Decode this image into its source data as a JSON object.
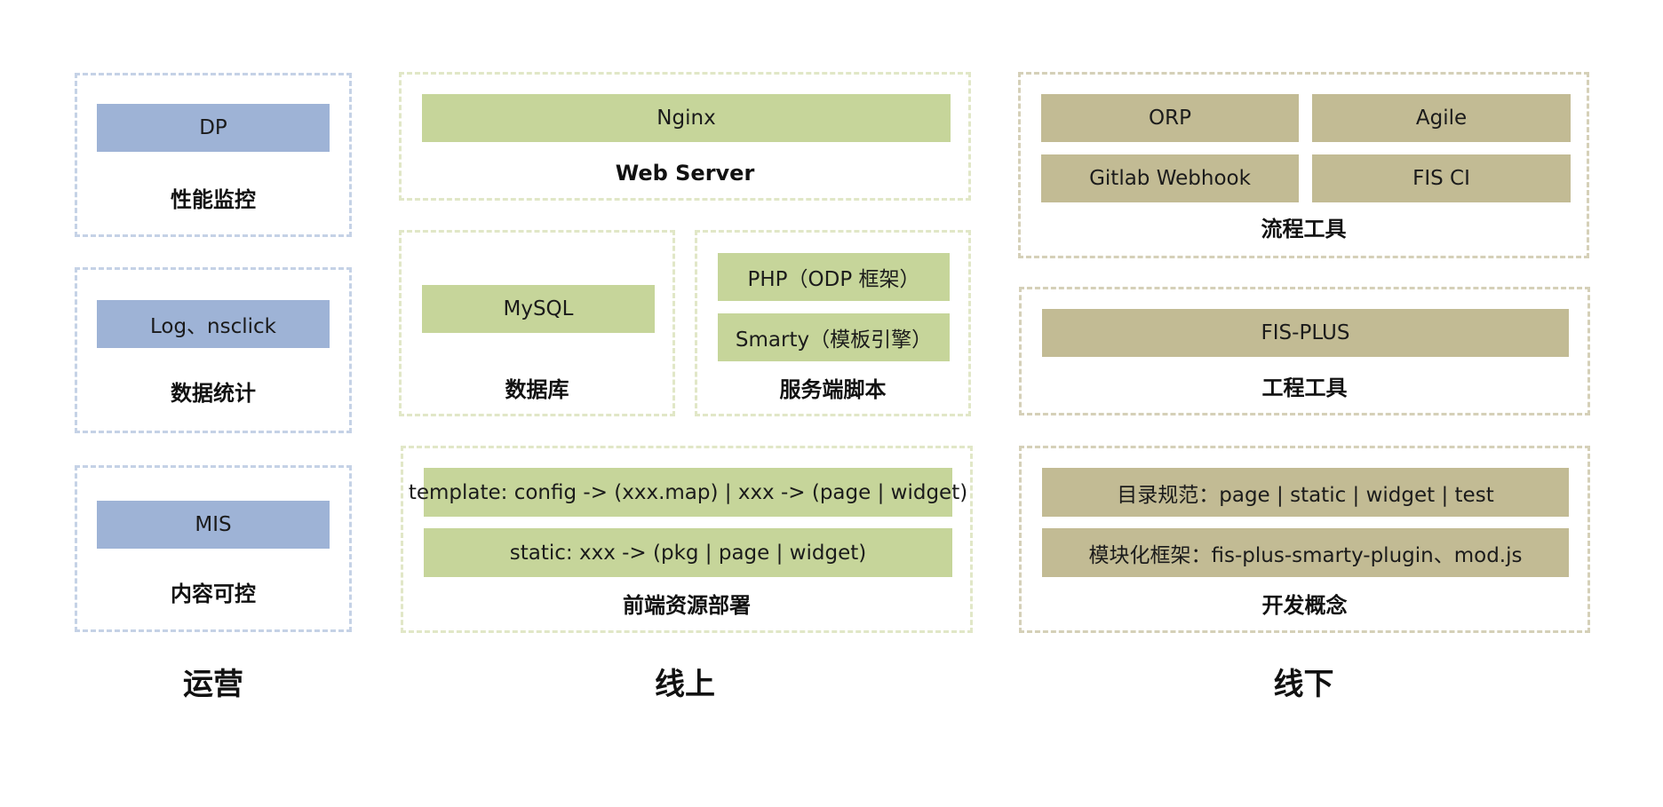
{
  "colors": {
    "ops_bar": "#9eb3d6",
    "online_bar": "#c6d59a",
    "offline_bar": "#c2bb94",
    "ops_border": "#c5d2e6",
    "online_border": "#e1e7c7",
    "offline_border": "#d5d0b8"
  },
  "columns": {
    "ops": "运营",
    "online": "线上",
    "offline": "线下"
  },
  "ops": {
    "perf": {
      "item": "DP",
      "label": "性能监控"
    },
    "stats": {
      "item": "Log、nsclick",
      "label": "数据统计"
    },
    "content": {
      "item": "MIS",
      "label": "内容可控"
    }
  },
  "online": {
    "webserver": {
      "item": "Nginx",
      "label": "Web Server"
    },
    "database": {
      "item": "MySQL",
      "label": "数据库"
    },
    "script": {
      "items": [
        "PHP（ODP 框架）",
        "Smarty（模板引擎）"
      ],
      "label": "服务端脚本"
    },
    "deploy": {
      "items": [
        "template: config -> (xxx.map) | xxx -> (page | widget)",
        "static: xxx -> (pkg | page | widget)"
      ],
      "label": "前端资源部署"
    }
  },
  "offline": {
    "process": {
      "items": [
        "ORP",
        "Agile",
        "Gitlab Webhook",
        "FIS CI"
      ],
      "label": "流程工具"
    },
    "engineering": {
      "item": "FIS-PLUS",
      "label": "工程工具"
    },
    "concepts": {
      "items": [
        "目录规范：page | static | widget | test",
        "模块化框架：fis-plus-smarty-plugin、mod.js"
      ],
      "label": "开发概念"
    }
  }
}
